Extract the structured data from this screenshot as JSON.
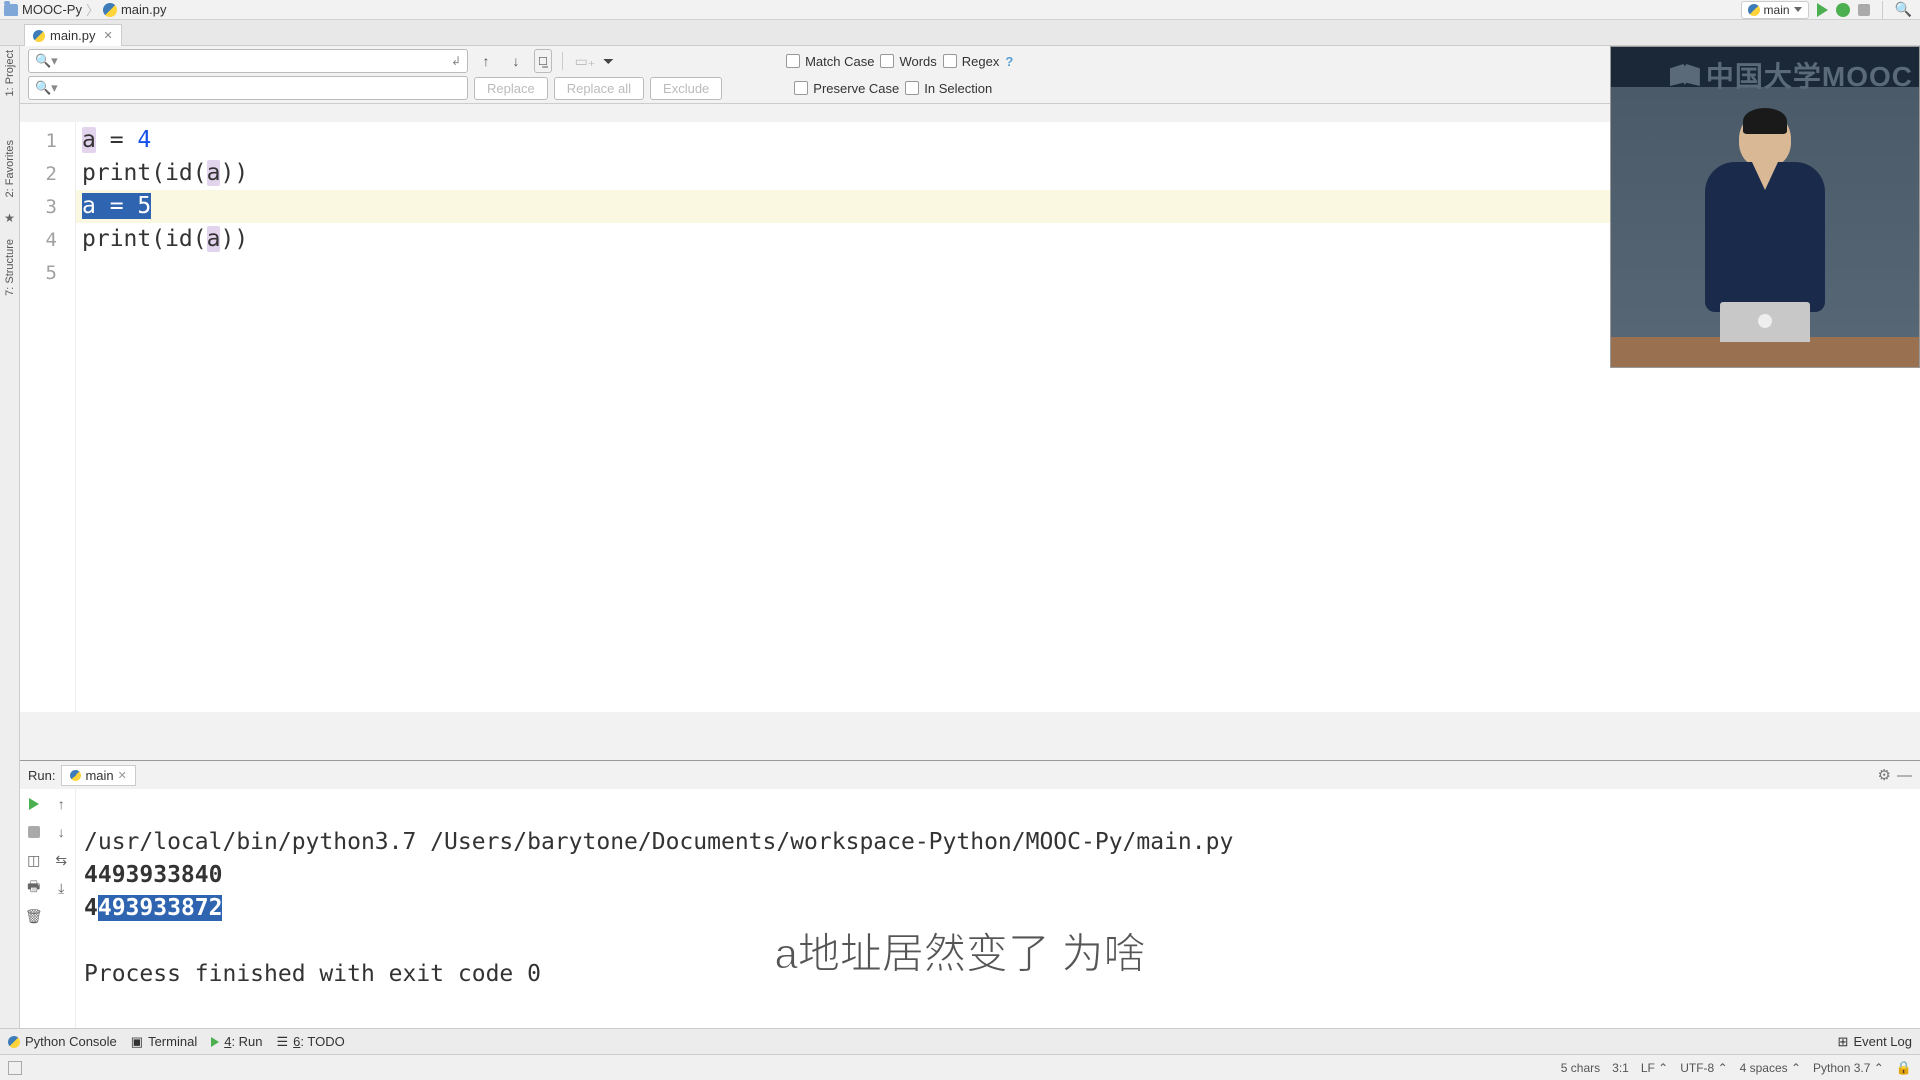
{
  "breadcrumb": {
    "project": "MOOC-Py",
    "file": "main.py"
  },
  "nav": {
    "run_config": "main"
  },
  "tab": {
    "filename": "main.py"
  },
  "find": {
    "match_case": "Match Case",
    "words": "Words",
    "regex": "Regex",
    "replace_btn": "Replace",
    "replace_all_btn": "Replace all",
    "exclude_btn": "Exclude",
    "preserve_case": "Preserve Case",
    "in_selection": "In Selection"
  },
  "left_tools": {
    "project": "1: Project",
    "favorites": "2: Favorites",
    "structure": "7: Structure"
  },
  "editor": {
    "lines": [
      "1",
      "2",
      "3",
      "4",
      "5"
    ],
    "l1_a": "a",
    "l1_eq": " = ",
    "l1_v": "4",
    "l2": "print(id(",
    "l2_a": "a",
    "l2_end": "))",
    "l3_a": "a",
    "l3_rest": " = 5",
    "l4": "print(id(",
    "l4_a": "a",
    "l4_end": "))"
  },
  "run": {
    "label": "Run:",
    "tab": "main",
    "cmd": "/usr/local/bin/python3.7 /Users/barytone/Documents/workspace-Python/MOOC-Py/main.py",
    "out1": "4493933840",
    "out2_pre": "4",
    "out2_sel": "493933872",
    "exit": "Process finished with exit code 0"
  },
  "bottom_tools": {
    "python_console": "Python Console",
    "terminal": "Terminal",
    "run": "4: Run",
    "todo": "6: TODO",
    "event_log": "Event Log"
  },
  "status": {
    "chars": "5 chars",
    "pos": "3:1",
    "sep": "LF",
    "enc": "UTF-8",
    "indent": "4 spaces",
    "py": "Python 3.7"
  },
  "mooc_logo": "中国大学MOOC",
  "subtitle": "a地址居然变了  为啥"
}
